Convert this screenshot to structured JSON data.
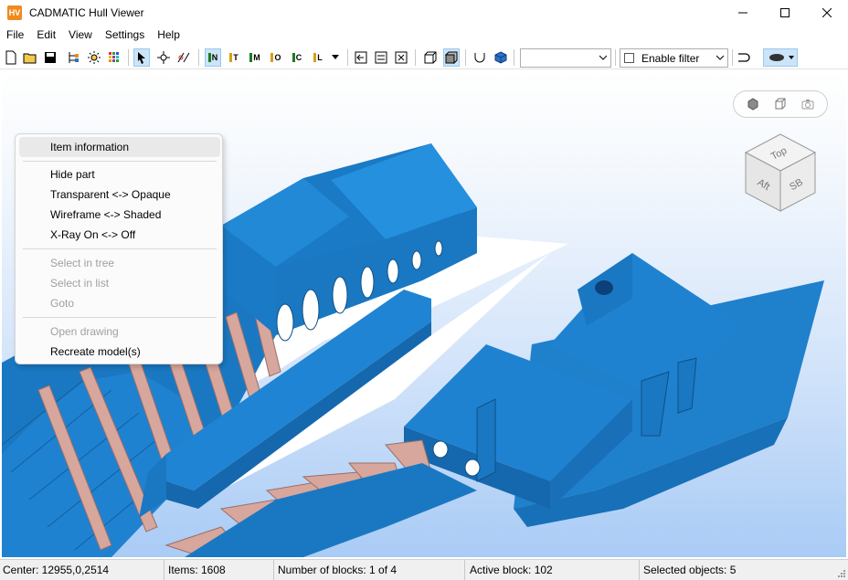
{
  "window": {
    "app_icon_text": "HV",
    "title": "CADMATIC Hull Viewer"
  },
  "menu": {
    "items": [
      "File",
      "Edit",
      "View",
      "Settings",
      "Help"
    ]
  },
  "toolbar": {
    "layer_buttons": [
      "N",
      "T",
      "M",
      "O",
      "C",
      "L"
    ],
    "view_combo_value": "",
    "filter_label": "Enable filter",
    "colors": {
      "N": "#1f7a1f",
      "T": "#d4a017",
      "M": "#1f7a1f",
      "O": "#d4a017",
      "C": "#1f7a1f",
      "L": "#d4a017"
    }
  },
  "viewport": {
    "navcube_labels": {
      "top": "Top",
      "aft": "Aft",
      "sb": "SB"
    },
    "view_tools": [
      "box-view-icon",
      "cube-view-icon",
      "camera-icon"
    ],
    "colors": {
      "hull": "#1a78c2",
      "hull_dark": "#145f9c",
      "frame": "#d9a49a",
      "deck": "#ffffff"
    }
  },
  "context_menu": {
    "items": [
      {
        "label": "Item information",
        "state": "highlighted"
      },
      {
        "label": "Hide part",
        "state": "enabled"
      },
      {
        "label": "Transparent <-> Opaque",
        "state": "enabled"
      },
      {
        "label": "Wireframe <-> Shaded",
        "state": "enabled"
      },
      {
        "label": "X-Ray On <-> Off",
        "state": "enabled"
      },
      {
        "label": "Select in tree",
        "state": "disabled"
      },
      {
        "label": "Select in list",
        "state": "disabled"
      },
      {
        "label": "Goto",
        "state": "disabled"
      },
      {
        "label": "Open drawing",
        "state": "disabled"
      },
      {
        "label": "Recreate model(s)",
        "state": "enabled"
      }
    ]
  },
  "status": {
    "center": "Center: 12955,0,2514",
    "items": "Items: 1608",
    "blocks": "Number of blocks: 1 of 4",
    "active_block": "Active block: 102",
    "selected": "Selected objects: 5"
  }
}
